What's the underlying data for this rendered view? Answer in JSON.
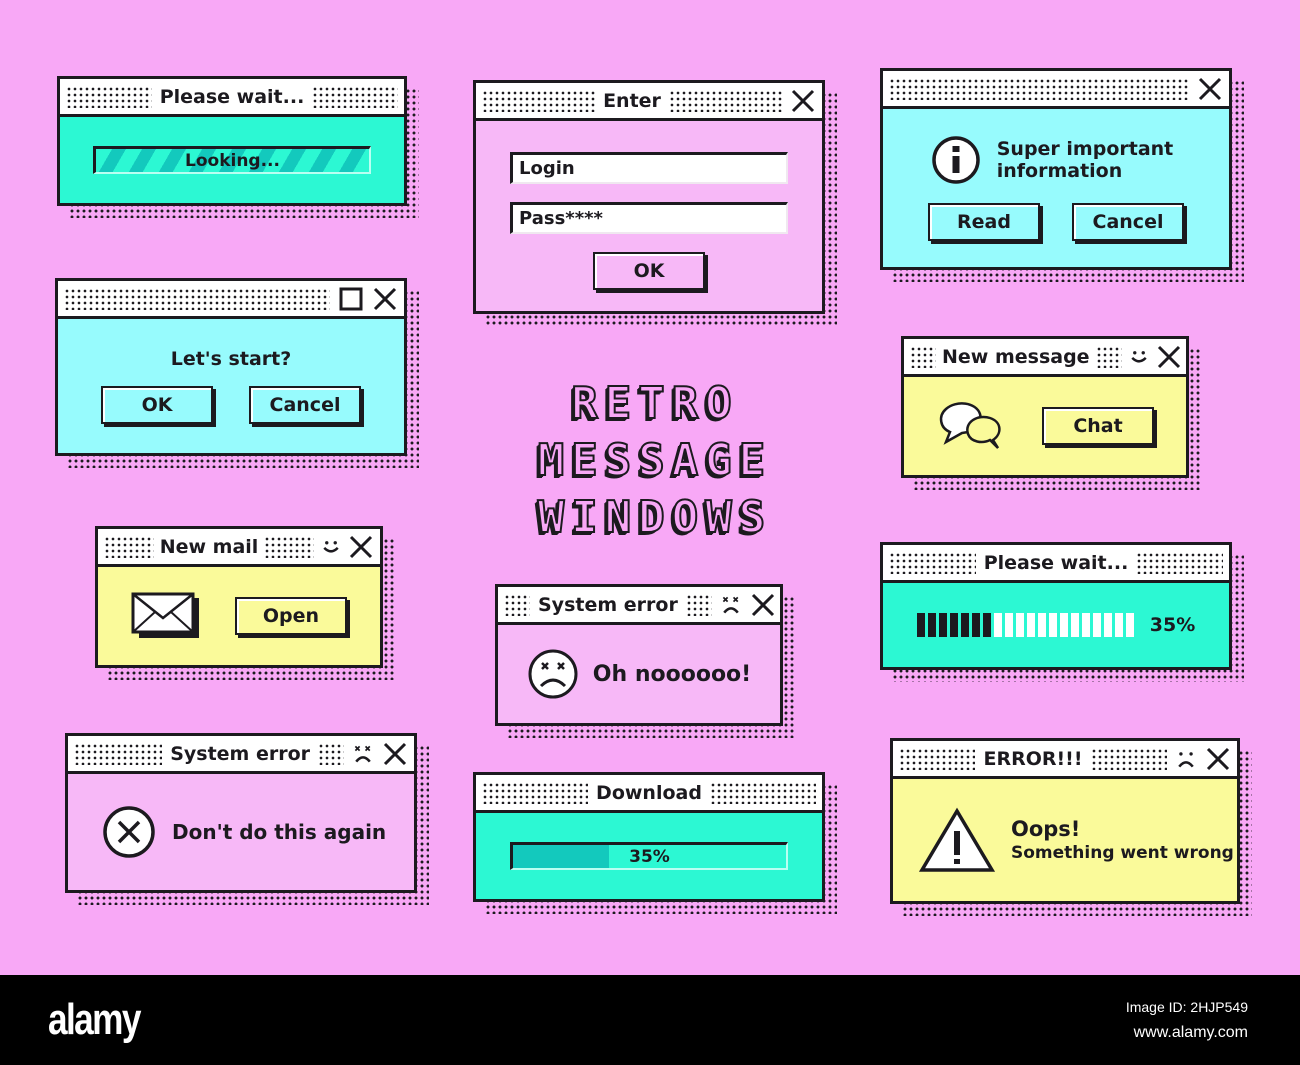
{
  "headline": {
    "lines": [
      "RETRO",
      "MESSAGE",
      "WINDOWS"
    ]
  },
  "colors": {
    "background": "#f8a8f6",
    "ink": "#1c1a1f",
    "teal": "#2cf8d3",
    "cyan": "#97fbfd",
    "pink": "#f7b8f7",
    "yellow": "#fafa9a",
    "titlebar": "#ffffff"
  },
  "windows": {
    "please_wait_looking": {
      "title": "Please wait...",
      "progress_label": "Looking...",
      "icons": []
    },
    "enter_login": {
      "title": "Enter",
      "login_value": "Login",
      "password_value": "Pass****",
      "ok_label": "OK",
      "icons": [
        "close-icon"
      ]
    },
    "super_important": {
      "title": "",
      "message_line1": "Super important",
      "message_line2": "information",
      "read_label": "Read",
      "cancel_label": "Cancel",
      "icons": [
        "info-icon",
        "close-icon"
      ]
    },
    "lets_start": {
      "title": "",
      "message": "Let's start?",
      "ok_label": "OK",
      "cancel_label": "Cancel",
      "icons": [
        "maximize-icon",
        "close-icon"
      ]
    },
    "new_message": {
      "title": "New message",
      "chat_label": "Chat",
      "icons": [
        "smile-icon",
        "close-icon",
        "chat-bubbles-icon"
      ]
    },
    "new_mail": {
      "title": "New mail",
      "open_label": "Open",
      "icons": [
        "smile-icon",
        "close-icon",
        "envelope-icon"
      ]
    },
    "system_error_oh_no": {
      "title": "System error",
      "message": "Oh noooooo!",
      "icons": [
        "sad-face-icon",
        "close-icon",
        "dizzy-sad-face-icon"
      ]
    },
    "please_wait_segments": {
      "title": "Please wait...",
      "progress_percent": 35,
      "progress_text": "35%",
      "segments_total": 20,
      "segments_filled": 7
    },
    "system_error_dont": {
      "title": "System error",
      "message": "Don't do this again",
      "icons": [
        "sad-face-icon",
        "close-icon",
        "error-x-icon"
      ]
    },
    "download": {
      "title": "Download",
      "progress_percent": 35,
      "progress_text": "35%"
    },
    "error_oops": {
      "title": "ERROR!!!",
      "message_line1": "Oops!",
      "message_line2": "Something went wrong",
      "icons": [
        "sad-face-icon",
        "close-icon",
        "warning-icon"
      ]
    }
  },
  "footer": {
    "logo": "alamy",
    "image_id": "Image ID: 2HJP549",
    "site": "www.alamy.com"
  }
}
